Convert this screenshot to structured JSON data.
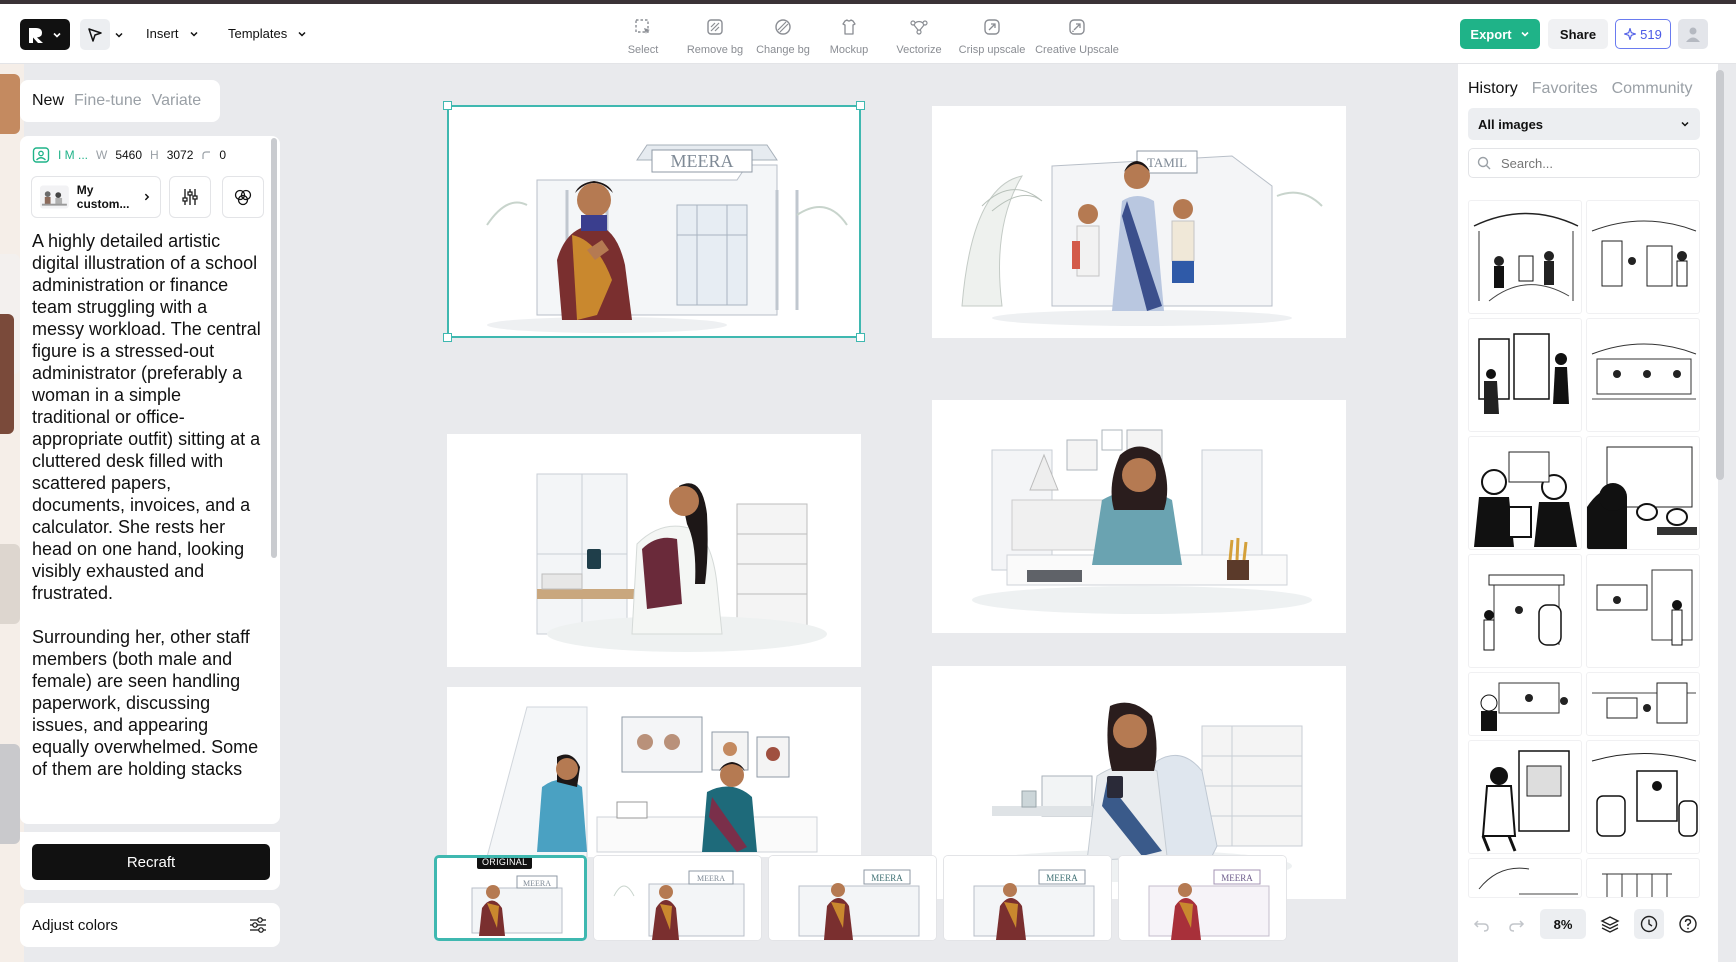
{
  "app": {
    "menus": [
      {
        "label": "Insert"
      },
      {
        "label": "Templates"
      }
    ],
    "tools": [
      {
        "label": "Select",
        "icon": "select-icon"
      },
      {
        "label": "Remove bg",
        "icon": "remove-bg-icon"
      },
      {
        "label": "Change bg",
        "icon": "change-bg-icon"
      },
      {
        "label": "Mockup",
        "icon": "mockup-icon"
      },
      {
        "label": "Vectorize",
        "icon": "vectorize-icon"
      },
      {
        "label": "Crisp upscale",
        "icon": "crisp-upscale-icon"
      },
      {
        "label": "Creative Upscale",
        "icon": "creative-upscale-icon"
      }
    ],
    "export_label": "Export",
    "share_label": "Share",
    "credits": "519",
    "accent": "#1fb388"
  },
  "left": {
    "tabs": [
      {
        "label": "New"
      },
      {
        "label": "Fine-tune"
      },
      {
        "label": "Variate"
      }
    ],
    "meta": {
      "image_label": "I M ...",
      "w_label": "W",
      "w": "5460",
      "h_label": "H",
      "h": "3072",
      "r": "0"
    },
    "style_label": "My custom...",
    "prompt": "A highly detailed artistic digital illustration of a school administration or finance team struggling with a messy workload. The central figure is a stressed-out administrator (preferably a woman in a simple traditional or office-appropriate outfit) sitting at a cluttered desk filled with scattered papers, documents, invoices, and a calculator. She rests her head on one hand, looking visibly exhausted and frustrated.\n\nSurrounding her, other staff members (both male and female) are seen handling paperwork, discussing issues, and appearing equally overwhelmed. Some of them are holding stacks",
    "recraft_label": "Recraft",
    "adjust_label": "Adjust colors"
  },
  "canvas": {
    "signs": {
      "meera": "MEERA",
      "tamil": "TAMIL"
    },
    "original_badge": "ORIGINAL",
    "variant_sign": "MEERA"
  },
  "right": {
    "tabs": [
      {
        "label": "History"
      },
      {
        "label": "Favorites"
      },
      {
        "label": "Community"
      }
    ],
    "filter": "All images",
    "search_placeholder": "Search...",
    "zoom": "8%"
  }
}
